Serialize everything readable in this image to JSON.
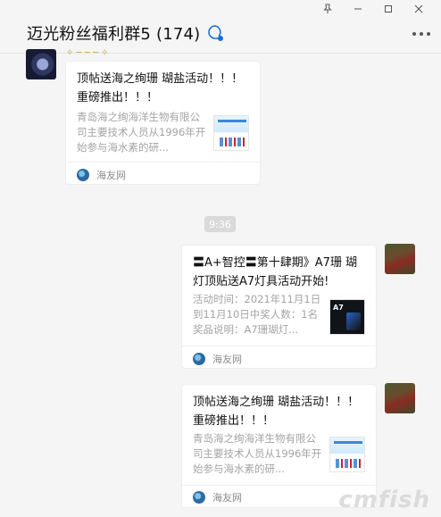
{
  "window": {
    "controls": [
      "pin",
      "minimize",
      "maximize",
      "close"
    ]
  },
  "header": {
    "title": "迈光粉丝福利群5 (174)",
    "more_label": "···"
  },
  "messages": [
    {
      "side": "left",
      "title": "顶帖送海之绚珊 瑚盐活动！！！ 重磅推出！！！",
      "description": "青岛海之绚海洋生物有限公司主要技术人员从1996年开始参与海水素的研...",
      "source": "海友网"
    },
    {
      "side": "right",
      "title": "〓A+智控〓第十肆期》A7珊 瑚灯顶贴送A7灯具活动开始!",
      "description": "活动时间：2021年11月1日到11月10日中奖人数：1名奖品说明：A7珊瑚灯...",
      "thumb_text": "A7",
      "source": "海友网"
    },
    {
      "side": "right",
      "title": "顶帖送海之绚珊 瑚盐活动！！！ 重磅推出！！！",
      "description": "青岛海之绚海洋生物有限公司主要技术人员从1996年开始参与海水素的研...",
      "source": "海友网"
    }
  ],
  "timestamp": "9:36",
  "watermark": "cmfish"
}
